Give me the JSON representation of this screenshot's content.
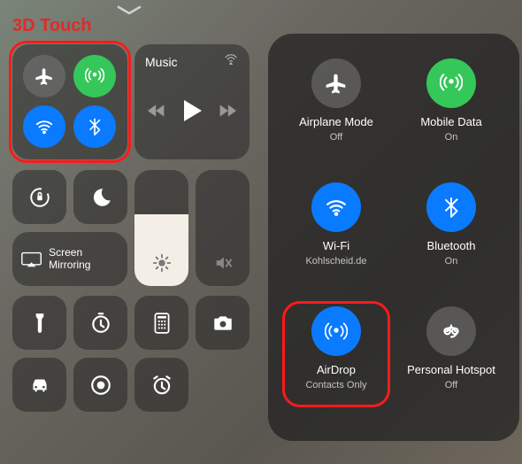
{
  "callout": "3D Touch",
  "left": {
    "music_title": "Music",
    "mirror_label": "Screen Mirroring"
  },
  "right": {
    "items": [
      {
        "label": "Airplane Mode",
        "sub": "Off"
      },
      {
        "label": "Mobile Data",
        "sub": "On"
      },
      {
        "label": "Wi-Fi",
        "sub": "Kohlscheid.de"
      },
      {
        "label": "Bluetooth",
        "sub": "On"
      },
      {
        "label": "AirDrop",
        "sub": "Contacts Only"
      },
      {
        "label": "Personal Hotspot",
        "sub": "Off"
      }
    ]
  },
  "colors": {
    "blue": "#0a7aff",
    "green": "#35c759",
    "gray": "rgba(120,120,120,.55)",
    "highlight": "#ff1a1a"
  },
  "sliders": {
    "brightness_pct": 62,
    "volume_pct": 0
  }
}
